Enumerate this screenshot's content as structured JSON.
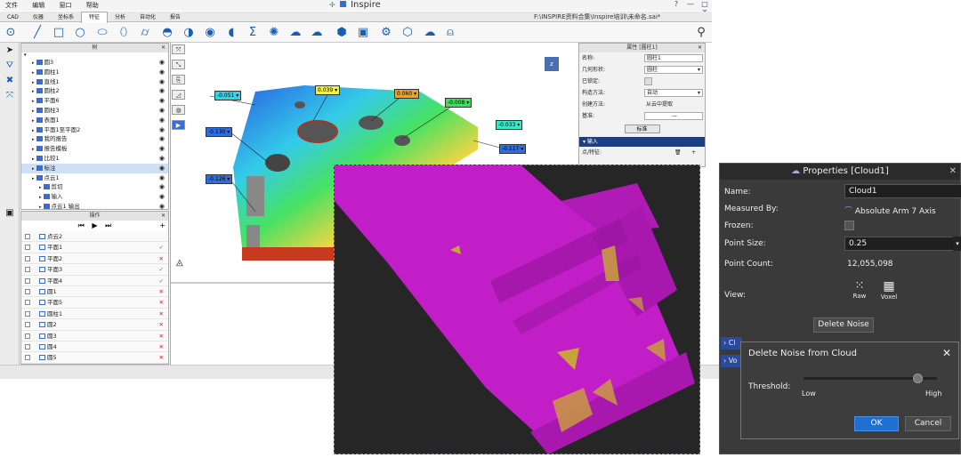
{
  "menu": [
    "文件",
    "编辑",
    "窗口",
    "帮助"
  ],
  "app_title": "Inspire",
  "window_controls": [
    "?",
    "—",
    "□",
    "✕"
  ],
  "tabs": [
    {
      "label": "CAD",
      "active": false
    },
    {
      "label": "仪器",
      "active": false
    },
    {
      "label": "坐标系",
      "active": false
    },
    {
      "label": "特征",
      "active": true
    },
    {
      "label": "分析",
      "active": false
    },
    {
      "label": "自动化",
      "active": false
    },
    {
      "label": "报告",
      "active": false
    }
  ],
  "file_path": "F:\\INSPIRE资料合集\\Inspire培训\\未命名.sai*",
  "toolbar_icons": [
    "point-icon",
    "line-icon",
    "square-icon",
    "circle-icon",
    "slot-icon",
    "ellipse-icon",
    "cylinder-icon",
    "cone-icon",
    "sphere-icon",
    "torus-icon",
    "surface-icon",
    "sum-icon",
    "cloud-icon",
    "cloud-icon",
    "cube-icon",
    "cube-icon",
    "gear-icon",
    "cube-icon",
    "cloud-icon",
    "probe-icon"
  ],
  "tree_panel": {
    "title": "树",
    "items": [
      {
        "label": "圆3",
        "indent": 1
      },
      {
        "label": "圆柱1",
        "indent": 1
      },
      {
        "label": "直线1",
        "indent": 1
      },
      {
        "label": "圆柱2",
        "indent": 1
      },
      {
        "label": "平面6",
        "indent": 1
      },
      {
        "label": "圆柱3",
        "indent": 1
      },
      {
        "label": "表面1",
        "indent": 1
      },
      {
        "label": "平面1至平面2",
        "indent": 1
      },
      {
        "label": "我的报告",
        "indent": 1
      },
      {
        "label": "报告模板",
        "indent": 1
      },
      {
        "label": "比较1",
        "indent": 1
      },
      {
        "label": "标注",
        "indent": 1,
        "selected": true
      },
      {
        "label": "点云1",
        "indent": 1
      },
      {
        "label": "剪切",
        "indent": 2
      },
      {
        "label": "输入",
        "indent": 2
      },
      {
        "label": "点云1 输出",
        "indent": 2
      }
    ]
  },
  "op_panel": {
    "title": "操作",
    "rows": [
      {
        "label": "点云2",
        "status": ""
      },
      {
        "label": "平面1",
        "status": "ok"
      },
      {
        "label": "平面2",
        "status": "no"
      },
      {
        "label": "平面3",
        "status": "ok"
      },
      {
        "label": "平面4",
        "status": "ok"
      },
      {
        "label": "圆1",
        "status": "no"
      },
      {
        "label": "平面5",
        "status": "no"
      },
      {
        "label": "圆柱1",
        "status": "no"
      },
      {
        "label": "圆2",
        "status": "no"
      },
      {
        "label": "圆3",
        "status": "no"
      },
      {
        "label": "圆4",
        "status": "no"
      },
      {
        "label": "圆5",
        "status": "no"
      }
    ]
  },
  "deviation_labels": [
    {
      "text": "-0.051",
      "color": "#35d3e8"
    },
    {
      "text": "0.039",
      "color": "#f2f23a"
    },
    {
      "text": "0.060",
      "color": "#f2a21a"
    },
    {
      "text": "-0.008",
      "color": "#3ee05a"
    },
    {
      "text": "-0.033",
      "color": "#35e8c8"
    },
    {
      "text": "-0.130",
      "color": "#2f6de0"
    },
    {
      "text": "-0.117",
      "color": "#2f6de0"
    },
    {
      "text": "-0.126",
      "color": "#2f6de0"
    }
  ],
  "properties_small": {
    "title": "属性 [圆柱1]",
    "rows": [
      {
        "label": "名称:",
        "value": "圆柱1",
        "kind": "input"
      },
      {
        "label": "几何形状:",
        "value": "圆柱",
        "kind": "select"
      },
      {
        "label": "已锁定:",
        "value": "",
        "kind": "check"
      },
      {
        "label": "构造方法:",
        "value": "自动",
        "kind": "select"
      },
      {
        "label": "创建方法:",
        "value": "从云中提取",
        "kind": "text"
      },
      {
        "label": "基准:",
        "value": "—",
        "kind": "input"
      }
    ],
    "button": "标准",
    "section": "输入",
    "footer_label": "点/特征:"
  },
  "properties": {
    "title": "Properties [Cloud1]",
    "name_label": "Name:",
    "name_value": "Cloud1",
    "measured_by_label": "Measured By:",
    "measured_by_value": "Absolute Arm 7 Axis",
    "frozen_label": "Frozen:",
    "point_size_label": "Point Size:",
    "point_size_value": "0.25",
    "point_count_label": "Point Count:",
    "point_count_value": "12,055,098",
    "view_label": "View:",
    "view_raw": "Raw",
    "view_voxel": "Voxel",
    "delete_noise_button": "Delete Noise",
    "collapsed_sections": [
      "Cl",
      "Vo"
    ]
  },
  "noise_dialog": {
    "title": "Delete Noise from Cloud",
    "threshold_label": "Threshold:",
    "low_label": "Low",
    "high_label": "High",
    "slider_value": 0.85,
    "ok": "OK",
    "cancel": "Cancel"
  },
  "colors": {
    "accent": "#1a5db5",
    "dialog_bg": "#3a3a3a",
    "ok_button": "#1f6fd0",
    "cloud_magenta": "#c21ec8"
  }
}
